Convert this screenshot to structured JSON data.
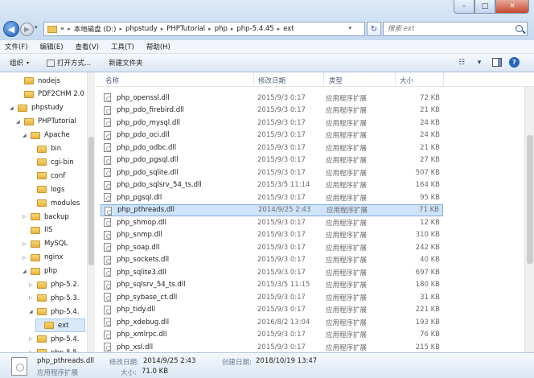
{
  "window": {
    "minimize_glyph": "–",
    "maximize_glyph": "□",
    "close_glyph": "✕"
  },
  "address": {
    "overflow": "«",
    "crumbs": [
      "本地磁盘 (D:)",
      "phpstudy",
      "PHPTutorial",
      "php",
      "php-5.4.45",
      "ext"
    ],
    "refresh_glyph": "↻"
  },
  "search": {
    "placeholder": "搜索 ext"
  },
  "menu": [
    "文件(F)",
    "编辑(E)",
    "查看(V)",
    "工具(T)",
    "帮助(H)"
  ],
  "toolbar": {
    "organize": "组织",
    "open_with": "打开方式...",
    "new_folder": "新建文件夹",
    "view_glyph": "☷",
    "arrow_glyph": "▾",
    "help_glyph": "?"
  },
  "nav_tree": [
    {
      "label": "nodejs",
      "expander": ""
    },
    {
      "label": "PDF2CHM 2.0",
      "expander": ""
    },
    {
      "label": "phpstudy",
      "expander": "◢"
    },
    {
      "label": "PHPTutorial",
      "expander": "◢"
    },
    {
      "label": "Apache",
      "expander": "◢"
    },
    {
      "label": "bin",
      "expander": ""
    },
    {
      "label": "cgi-bin",
      "expander": ""
    },
    {
      "label": "conf",
      "expander": ""
    },
    {
      "label": "logs",
      "expander": ""
    },
    {
      "label": "modules",
      "expander": ""
    },
    {
      "label": "backup",
      "expander": "▷"
    },
    {
      "label": "IIS",
      "expander": ""
    },
    {
      "label": "MySQL",
      "expander": "▷"
    },
    {
      "label": "nginx",
      "expander": "▷"
    },
    {
      "label": "php",
      "expander": "◢"
    },
    {
      "label": "php-5.2.",
      "expander": "▷"
    },
    {
      "label": "php-5.3.",
      "expander": "▷"
    },
    {
      "label": "php-5.4.",
      "expander": "◢"
    },
    {
      "label": "ext",
      "expander": ""
    },
    {
      "label": "php-5.4.",
      "expander": "▷"
    },
    {
      "label": "php-5.5.",
      "expander": "▷"
    }
  ],
  "columns": {
    "name": "名称",
    "date": "修改日期",
    "type": "类型",
    "size": "大小"
  },
  "files": [
    {
      "name": "php_openssl.dll",
      "date": "2015/9/3 0:17",
      "type": "应用程序扩展",
      "size": "72 KB"
    },
    {
      "name": "php_pdo_firebird.dll",
      "date": "2015/9/3 0:17",
      "type": "应用程序扩展",
      "size": "21 KB"
    },
    {
      "name": "php_pdo_mysql.dll",
      "date": "2015/9/3 0:17",
      "type": "应用程序扩展",
      "size": "24 KB"
    },
    {
      "name": "php_pdo_oci.dll",
      "date": "2015/9/3 0:17",
      "type": "应用程序扩展",
      "size": "24 KB"
    },
    {
      "name": "php_pdo_odbc.dll",
      "date": "2015/9/3 0:17",
      "type": "应用程序扩展",
      "size": "21 KB"
    },
    {
      "name": "php_pdo_pgsql.dll",
      "date": "2015/9/3 0:17",
      "type": "应用程序扩展",
      "size": "27 KB"
    },
    {
      "name": "php_pdo_sqlite.dll",
      "date": "2015/9/3 0:17",
      "type": "应用程序扩展",
      "size": "507 KB"
    },
    {
      "name": "php_pdo_sqlsrv_54_ts.dll",
      "date": "2015/3/5 11:14",
      "type": "应用程序扩展",
      "size": "164 KB"
    },
    {
      "name": "php_pgsql.dll",
      "date": "2015/9/3 0:17",
      "type": "应用程序扩展",
      "size": "95 KB"
    },
    {
      "name": "php_pthreads.dll",
      "date": "2014/9/25 2:43",
      "type": "应用程序扩展",
      "size": "71 KB",
      "selected": true
    },
    {
      "name": "php_shmop.dll",
      "date": "2015/9/3 0:17",
      "type": "应用程序扩展",
      "size": "12 KB"
    },
    {
      "name": "php_snmp.dll",
      "date": "2015/9/3 0:17",
      "type": "应用程序扩展",
      "size": "310 KB"
    },
    {
      "name": "php_soap.dll",
      "date": "2015/9/3 0:17",
      "type": "应用程序扩展",
      "size": "242 KB"
    },
    {
      "name": "php_sockets.dll",
      "date": "2015/9/3 0:17",
      "type": "应用程序扩展",
      "size": "40 KB"
    },
    {
      "name": "php_sqlite3.dll",
      "date": "2015/9/3 0:17",
      "type": "应用程序扩展",
      "size": "697 KB"
    },
    {
      "name": "php_sqlsrv_54_ts.dll",
      "date": "2015/3/5 11:15",
      "type": "应用程序扩展",
      "size": "180 KB"
    },
    {
      "name": "php_sybase_ct.dll",
      "date": "2015/9/3 0:17",
      "type": "应用程序扩展",
      "size": "31 KB"
    },
    {
      "name": "php_tidy.dll",
      "date": "2015/9/3 0:17",
      "type": "应用程序扩展",
      "size": "221 KB"
    },
    {
      "name": "php_xdebug.dll",
      "date": "2016/8/2 13:04",
      "type": "应用程序扩展",
      "size": "193 KB"
    },
    {
      "name": "php_xmlrpc.dll",
      "date": "2015/9/3 0:17",
      "type": "应用程序扩展",
      "size": "76 KB"
    },
    {
      "name": "php_xsl.dll",
      "date": "2015/9/3 0:17",
      "type": "应用程序扩展",
      "size": "215 KB"
    }
  ],
  "details": {
    "filename": "php_pthreads.dll",
    "modified_label": "修改日期:",
    "modified_value": "2014/9/25 2:43",
    "created_label": "创建日期:",
    "created_value": "2018/10/19 13:47",
    "type": "应用程序扩展",
    "size_label": "大小:",
    "size_value": "71.0 KB"
  }
}
